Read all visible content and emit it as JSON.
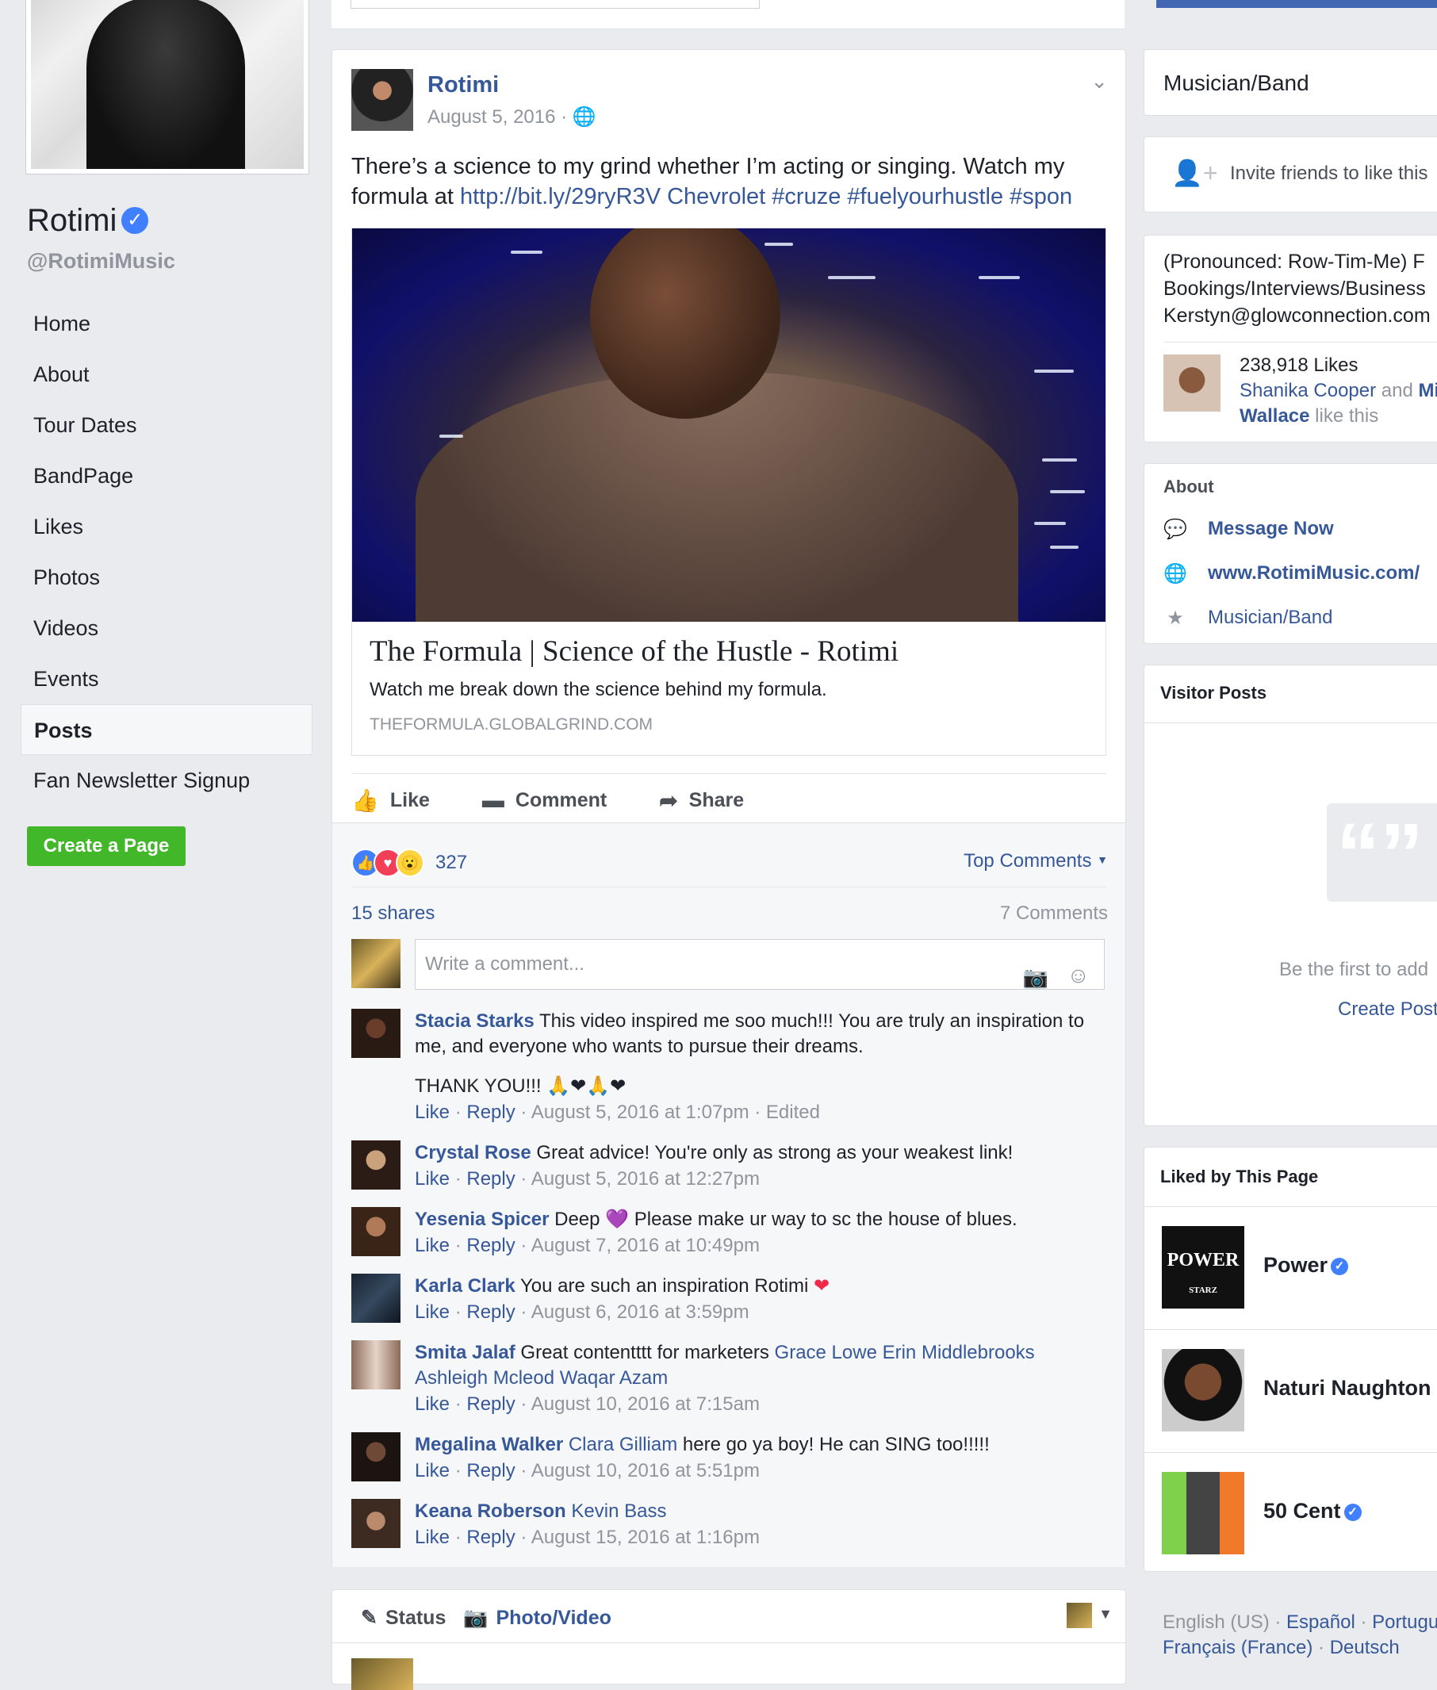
{
  "colors": {
    "accent": "#365899",
    "brand_blue": "#4267b2",
    "green": "#42b72a",
    "background": "#e9ebee"
  },
  "sidebar": {
    "page_name": "Rotimi",
    "verified_icon": "check",
    "handle": "@RotimiMusic",
    "nav": [
      {
        "label": "Home"
      },
      {
        "label": "About"
      },
      {
        "label": "Tour Dates"
      },
      {
        "label": "BandPage"
      },
      {
        "label": "Likes"
      },
      {
        "label": "Photos"
      },
      {
        "label": "Videos"
      },
      {
        "label": "Events"
      },
      {
        "label": "Posts",
        "active": true
      },
      {
        "label": "Fan Newsletter Signup"
      }
    ],
    "create_page": "Create a Page"
  },
  "post": {
    "author": "Rotimi",
    "date": "August 5, 2016 ·",
    "text_plain": "There’s a science to my grind whether I’m acting or singing. Watch my formula at ",
    "text_link": "http://bit.ly/29ryR3V Chevrolet #cruze #fuelyourhustle #spon",
    "link_card": {
      "title": "The Formula | Science of the Hustle - Rotimi",
      "description": "Watch me break down the science behind my formula.",
      "domain": "THEFORMULA.GLOBALGRIND.COM"
    },
    "actions": {
      "like": "Like",
      "comment": "Comment",
      "share": "Share"
    },
    "reactions_count": "327",
    "top_comments": "Top Comments",
    "shares": "15 shares",
    "comments_count": "7 Comments",
    "write_placeholder": "Write a comment...",
    "comments": [
      {
        "name": "Stacia Starks",
        "text": "This video inspired me soo much!!! You are truly an inspiration to me, and everyone who wants to pursue their dreams.",
        "extra": "THANK YOU!!! 🙏❤🙏❤",
        "like": "Like",
        "reply": "Reply",
        "time": "August 5, 2016 at 1:07pm · Edited"
      },
      {
        "name": "Crystal Rose",
        "text": "Great advice! You're only as strong as your weakest link!",
        "like": "Like",
        "reply": "Reply",
        "time": "August 5, 2016 at 12:27pm"
      },
      {
        "name": "Yesenia Spicer",
        "text_a": "Deep",
        "emoji": "💜",
        "text_b": "Please make ur way to sc the house of blues.",
        "like": "Like",
        "reply": "Reply",
        "time": "August 7, 2016 at 10:49pm"
      },
      {
        "name": "Karla Clark",
        "text": "You are such an inspiration Rotimi",
        "emoji": "❤",
        "like": "Like",
        "reply": "Reply",
        "time": "August 6, 2016 at 3:59pm"
      },
      {
        "name": "Smita Jalaf",
        "text": "Great contentttt for marketers",
        "tags": "Grace Lowe Erin Middlebrooks Ashleigh Mcleod Waqar Azam",
        "like": "Like",
        "reply": "Reply",
        "time": "August 10, 2016 at 7:15am"
      },
      {
        "name": "Megalina Walker",
        "tag": "Clara Gilliam",
        "text": "here go ya boy! He can SING too!!!!!",
        "like": "Like",
        "reply": "Reply",
        "time": "August 10, 2016 at 5:51pm"
      },
      {
        "name": "Keana Roberson",
        "tag": "Kevin Bass",
        "like": "Like",
        "reply": "Reply",
        "time": "August 15, 2016 at 1:16pm"
      }
    ]
  },
  "composer": {
    "status": "Status",
    "photo_video": "Photo/Video"
  },
  "right": {
    "category": "Musician/Band",
    "invite": "Invite friends to like this",
    "bio_lines": [
      "(Pronounced: Row-Tim-Me) F",
      "Bookings/Interviews/Business",
      "Kerstyn@glowconnection.com"
    ],
    "likes_count": "238,918 Likes",
    "likes_friends_a": "Shanika Cooper",
    "likes_and": "and",
    "likes_friends_b": "Mi",
    "likes_friends_c": "Wallace",
    "likes_suffix": "like this",
    "about_title": "About",
    "about_rows": [
      {
        "label": "Message Now",
        "icon": "messenger-icon"
      },
      {
        "label": "www.RotimiMusic.com/",
        "icon": "globe-icon"
      },
      {
        "label": "Musician/Band",
        "icon": "category-icon"
      }
    ],
    "visitor_title": "Visitor Posts",
    "visitor_empty": "Be the first to add",
    "visitor_create": "Create Post",
    "liked_title": "Liked by This Page",
    "liked": [
      {
        "name": "Power",
        "verified": true,
        "logo_text": "POWER",
        "logo_sub": "STARZ"
      },
      {
        "name": "Naturi Naughton",
        "verified": false
      },
      {
        "name": "50 Cent",
        "verified": true
      }
    ],
    "lang_current": "English (US) ·",
    "lang_a": "Español",
    "lang_b": "Portugu",
    "lang_c": "Français (France)",
    "lang_d": "Deutsch"
  }
}
